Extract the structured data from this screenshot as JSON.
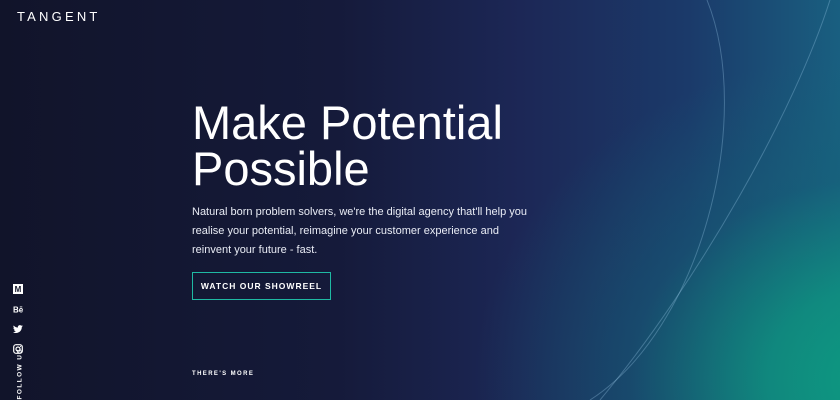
{
  "brand": {
    "logo": "TANGENT"
  },
  "hero": {
    "title_line1": "Make Potential",
    "title_line2": "Possible",
    "description": "Natural born problem solvers, we're the digital agency that'll help you realise your potential, reimagine your customer experience and reinvent your future - fast.",
    "cta_label": "WATCH OUR SHOWREEL",
    "more_label": "THERE'S MORE"
  },
  "social": {
    "follow_label": "FOLLOW US",
    "items": [
      {
        "icon": "medium-icon",
        "glyph": "M"
      },
      {
        "icon": "behance-icon",
        "glyph": "Bē"
      },
      {
        "icon": "twitter-icon"
      },
      {
        "icon": "instagram-icon"
      }
    ]
  },
  "colors": {
    "accent": "#1fb9a3",
    "background": "#111528",
    "glow": "#0d9a80"
  }
}
